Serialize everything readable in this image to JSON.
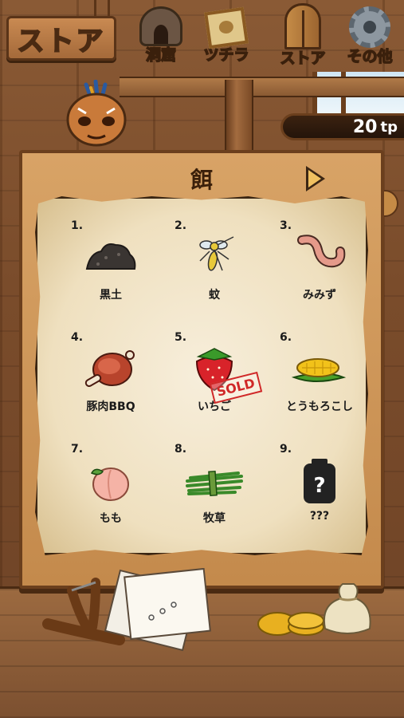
{
  "screen_title": "ストア",
  "nav": [
    {
      "label": "洞窟",
      "icon": "cave-icon",
      "active": false
    },
    {
      "label": "ツチラ",
      "icon": "tsuchira-frame-icon",
      "active": false
    },
    {
      "label": "ストア",
      "icon": "door-icon",
      "active": true
    },
    {
      "label": "その他",
      "icon": "gear-icon",
      "active": false
    }
  ],
  "points": {
    "value": "20",
    "unit": "tp"
  },
  "board": {
    "title": "餌"
  },
  "items": [
    {
      "number": "1.",
      "label": "黒土",
      "icon": "black-soil-icon",
      "sold": false
    },
    {
      "number": "2.",
      "label": "蚊",
      "icon": "mosquito-icon",
      "sold": false
    },
    {
      "number": "3.",
      "label": "みみず",
      "icon": "earthworm-icon",
      "sold": false
    },
    {
      "number": "4.",
      "label": "豚肉BBQ",
      "icon": "bbq-meat-icon",
      "sold": false
    },
    {
      "number": "5.",
      "label": "いちご",
      "icon": "strawberry-icon",
      "sold": true,
      "sold_text": "SOLD"
    },
    {
      "number": "6.",
      "label": "とうもろこし",
      "icon": "corn-icon",
      "sold": false
    },
    {
      "number": "7.",
      "label": "もも",
      "icon": "peach-icon",
      "sold": false
    },
    {
      "number": "8.",
      "label": "牧草",
      "icon": "grass-icon",
      "sold": false
    },
    {
      "number": "9.",
      "label": "???",
      "icon": "locked-jar-icon",
      "sold": false
    }
  ],
  "colors": {
    "active_nav": "#ffe000",
    "sold_stamp": "#d02828"
  }
}
